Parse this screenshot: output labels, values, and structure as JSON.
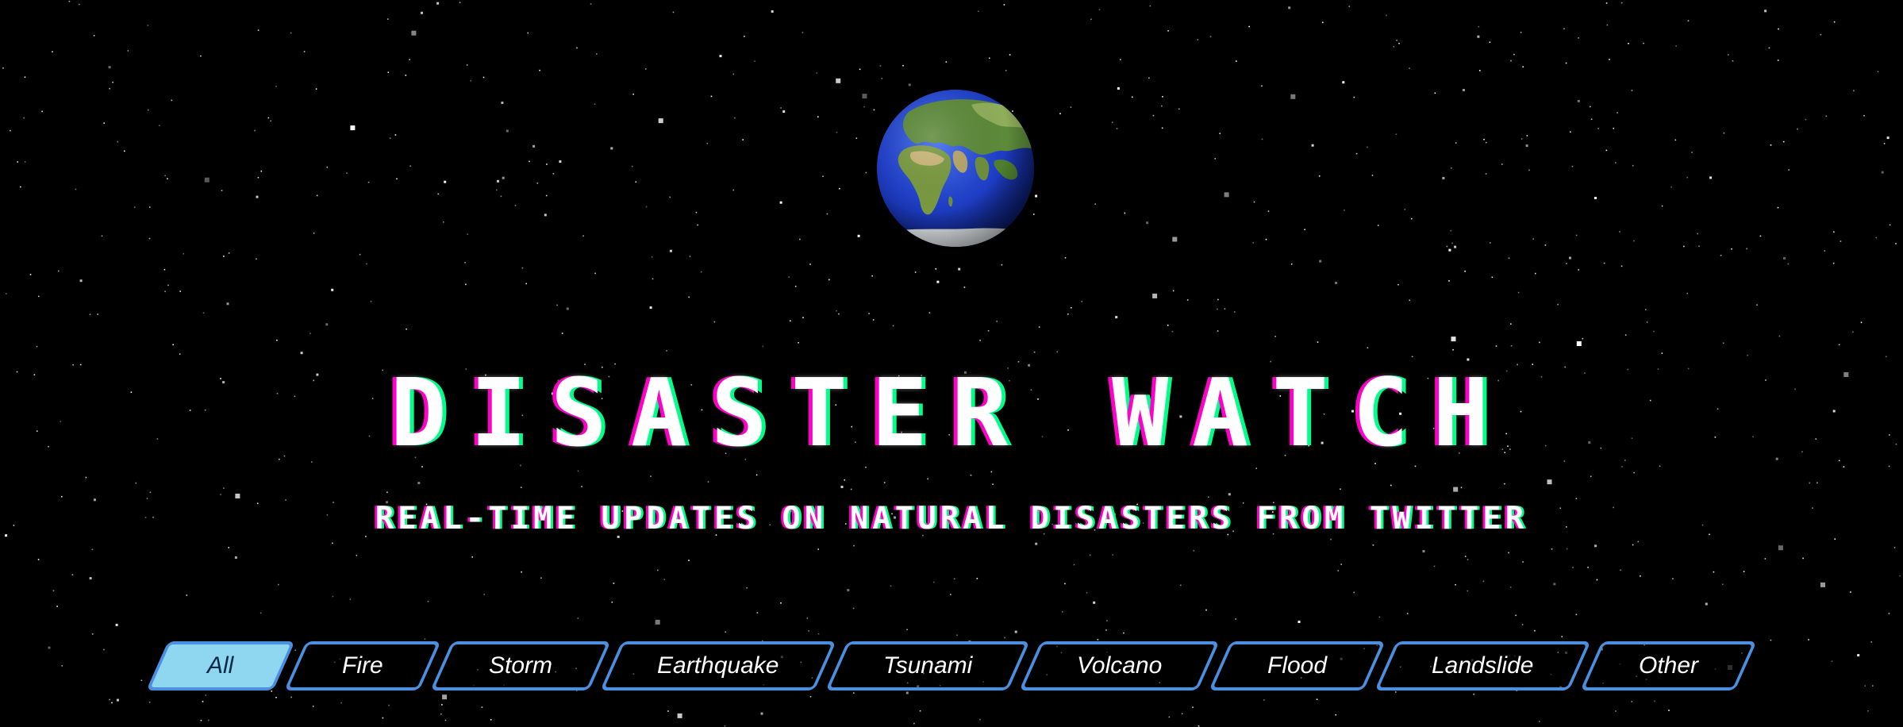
{
  "header": {
    "title": "DISASTER WATCH",
    "subtitle": "REAL-TIME UPDATES ON NATURAL DISASTERS FROM TWITTER"
  },
  "filters": {
    "items": [
      "All",
      "Fire",
      "Storm",
      "Earthquake",
      "Tsunami",
      "Volcano",
      "Flood",
      "Landslide",
      "Other"
    ],
    "selected": "All"
  },
  "colors": {
    "background": "#000000",
    "accent": "#4a8fe0",
    "active_fill": "#8fd6f0",
    "glitch_left": "#ff00c8",
    "glitch_right": "#00ff88"
  },
  "icons": {
    "globe": "earth-globe-icon"
  }
}
